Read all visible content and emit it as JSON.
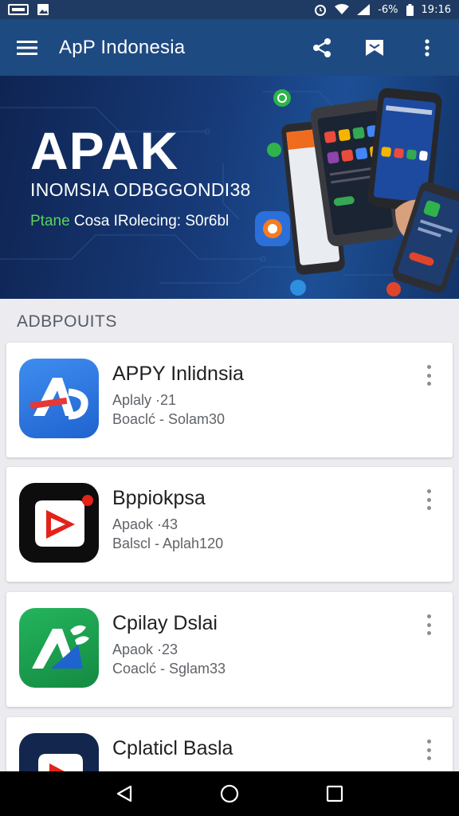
{
  "status_bar": {
    "battery": "-6%",
    "time": "19:16"
  },
  "app_bar": {
    "title": "ApP Indonesia",
    "icons": [
      "menu-icon",
      "share-icon",
      "flag-icon",
      "more-vert-icon"
    ]
  },
  "banner": {
    "title": "APAK",
    "subtitle": "INOMSIA ODBGGONDI38",
    "tagline_green": "Ptane",
    "tagline_rest": " Cosa IRolecing: S0r6bl"
  },
  "section": {
    "title": "ADBPOUITS"
  },
  "apps": [
    {
      "name": "APPY Inlidnsia",
      "line1": "Aplaly ·21",
      "line2": "Boaclć - Solam30",
      "icon": "app-a-icon",
      "bg": "#2a78e4"
    },
    {
      "name": "Bppiokpsa",
      "line1": "Apaok ·43",
      "line2": "Balscl - Aplah120",
      "icon": "play-icon",
      "bg": "#0d0d0d"
    },
    {
      "name": "Cpilay Dslai",
      "line1": "Apaok ·23",
      "line2": "Coaclć - Sglam33",
      "icon": "app-leaf-icon",
      "bg": "#1c9c4c"
    },
    {
      "name": "Cplaticl Basla",
      "line1": "",
      "line2": "",
      "icon": "play-icon",
      "bg": "#13264d"
    }
  ],
  "nav_bar": {
    "icons": [
      "back-icon",
      "home-icon",
      "recents-icon"
    ]
  }
}
